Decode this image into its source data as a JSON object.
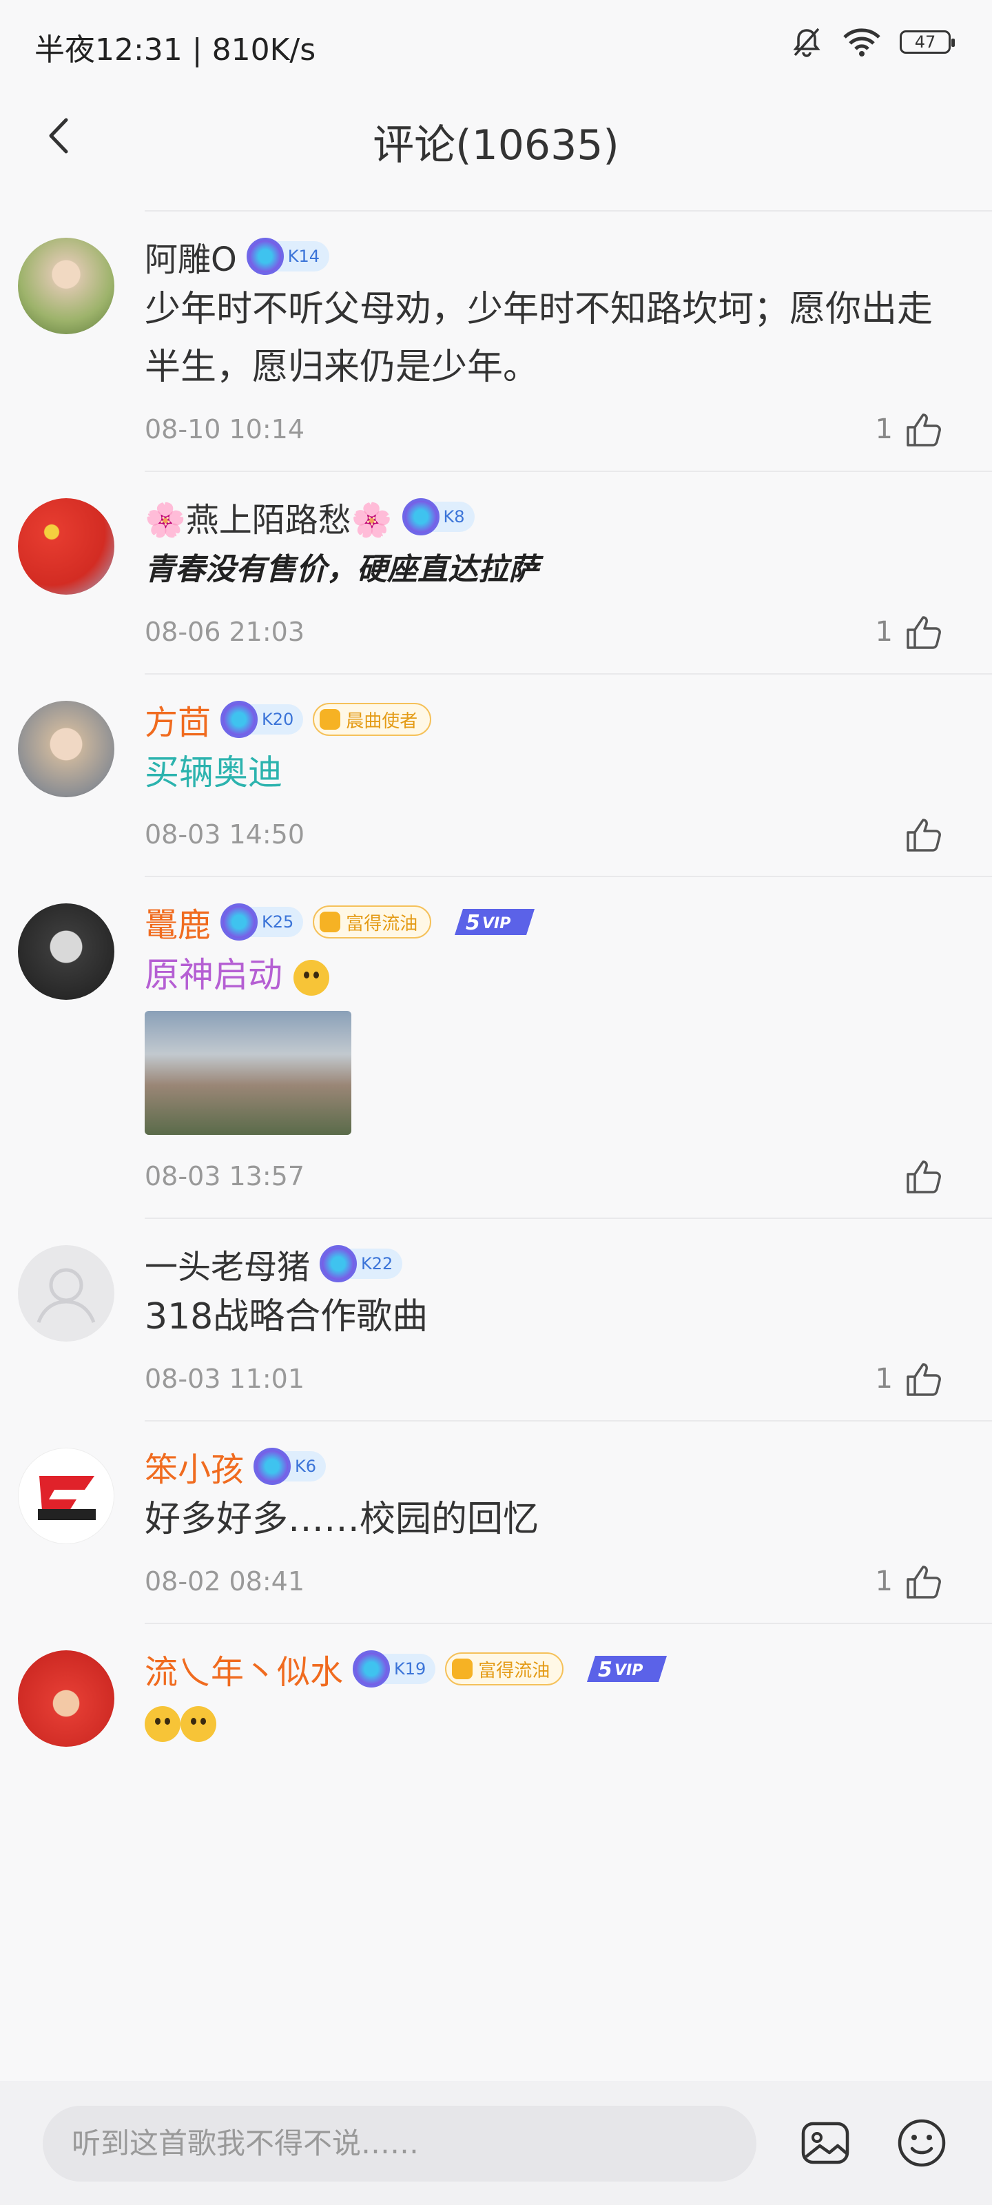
{
  "status_bar": {
    "time": "半夜12:31 | 810K/s",
    "battery": "47"
  },
  "header": {
    "title": "评论(10635)"
  },
  "comments": [
    {
      "name": "阿雕O",
      "level": "K14",
      "text": "少年时不听父母劝，少年时不知路坎坷；愿你出走半生，愿归来仍是少年。",
      "date": "08-10 10:14",
      "likes": "1"
    },
    {
      "name": "🌸燕上陌路愁🌸",
      "level": "K8",
      "text": "青春没有售价，硬座直达拉萨",
      "date": "08-06 21:03",
      "likes": "1"
    },
    {
      "name": "方茴",
      "level": "K20",
      "badge": "晨曲使者",
      "text": "买辆奥迪",
      "date": "08-03 14:50",
      "likes": ""
    },
    {
      "name": "鼍鹿",
      "level": "K25",
      "badge": "富得流油",
      "vip": "VIP",
      "text": "原神启动",
      "date": "08-03 13:57",
      "likes": ""
    },
    {
      "name": "一头老母猪",
      "level": "K22",
      "text": "318战略合作歌曲",
      "date": "08-03 11:01",
      "likes": "1"
    },
    {
      "name": "笨小孩",
      "level": "K6",
      "text": "好多好多……校园的回忆",
      "date": "08-02 08:41",
      "likes": "1"
    },
    {
      "name": "流乀年丶似水",
      "level": "K19",
      "badge": "富得流油",
      "vip": "VIP"
    }
  ],
  "bottom_bar": {
    "placeholder": "听到这首歌我不得不说……"
  },
  "colors": {
    "accent_orange": "#f06b1f",
    "level_blue": "#3b74d8",
    "badge_gold": "#e49b16"
  }
}
